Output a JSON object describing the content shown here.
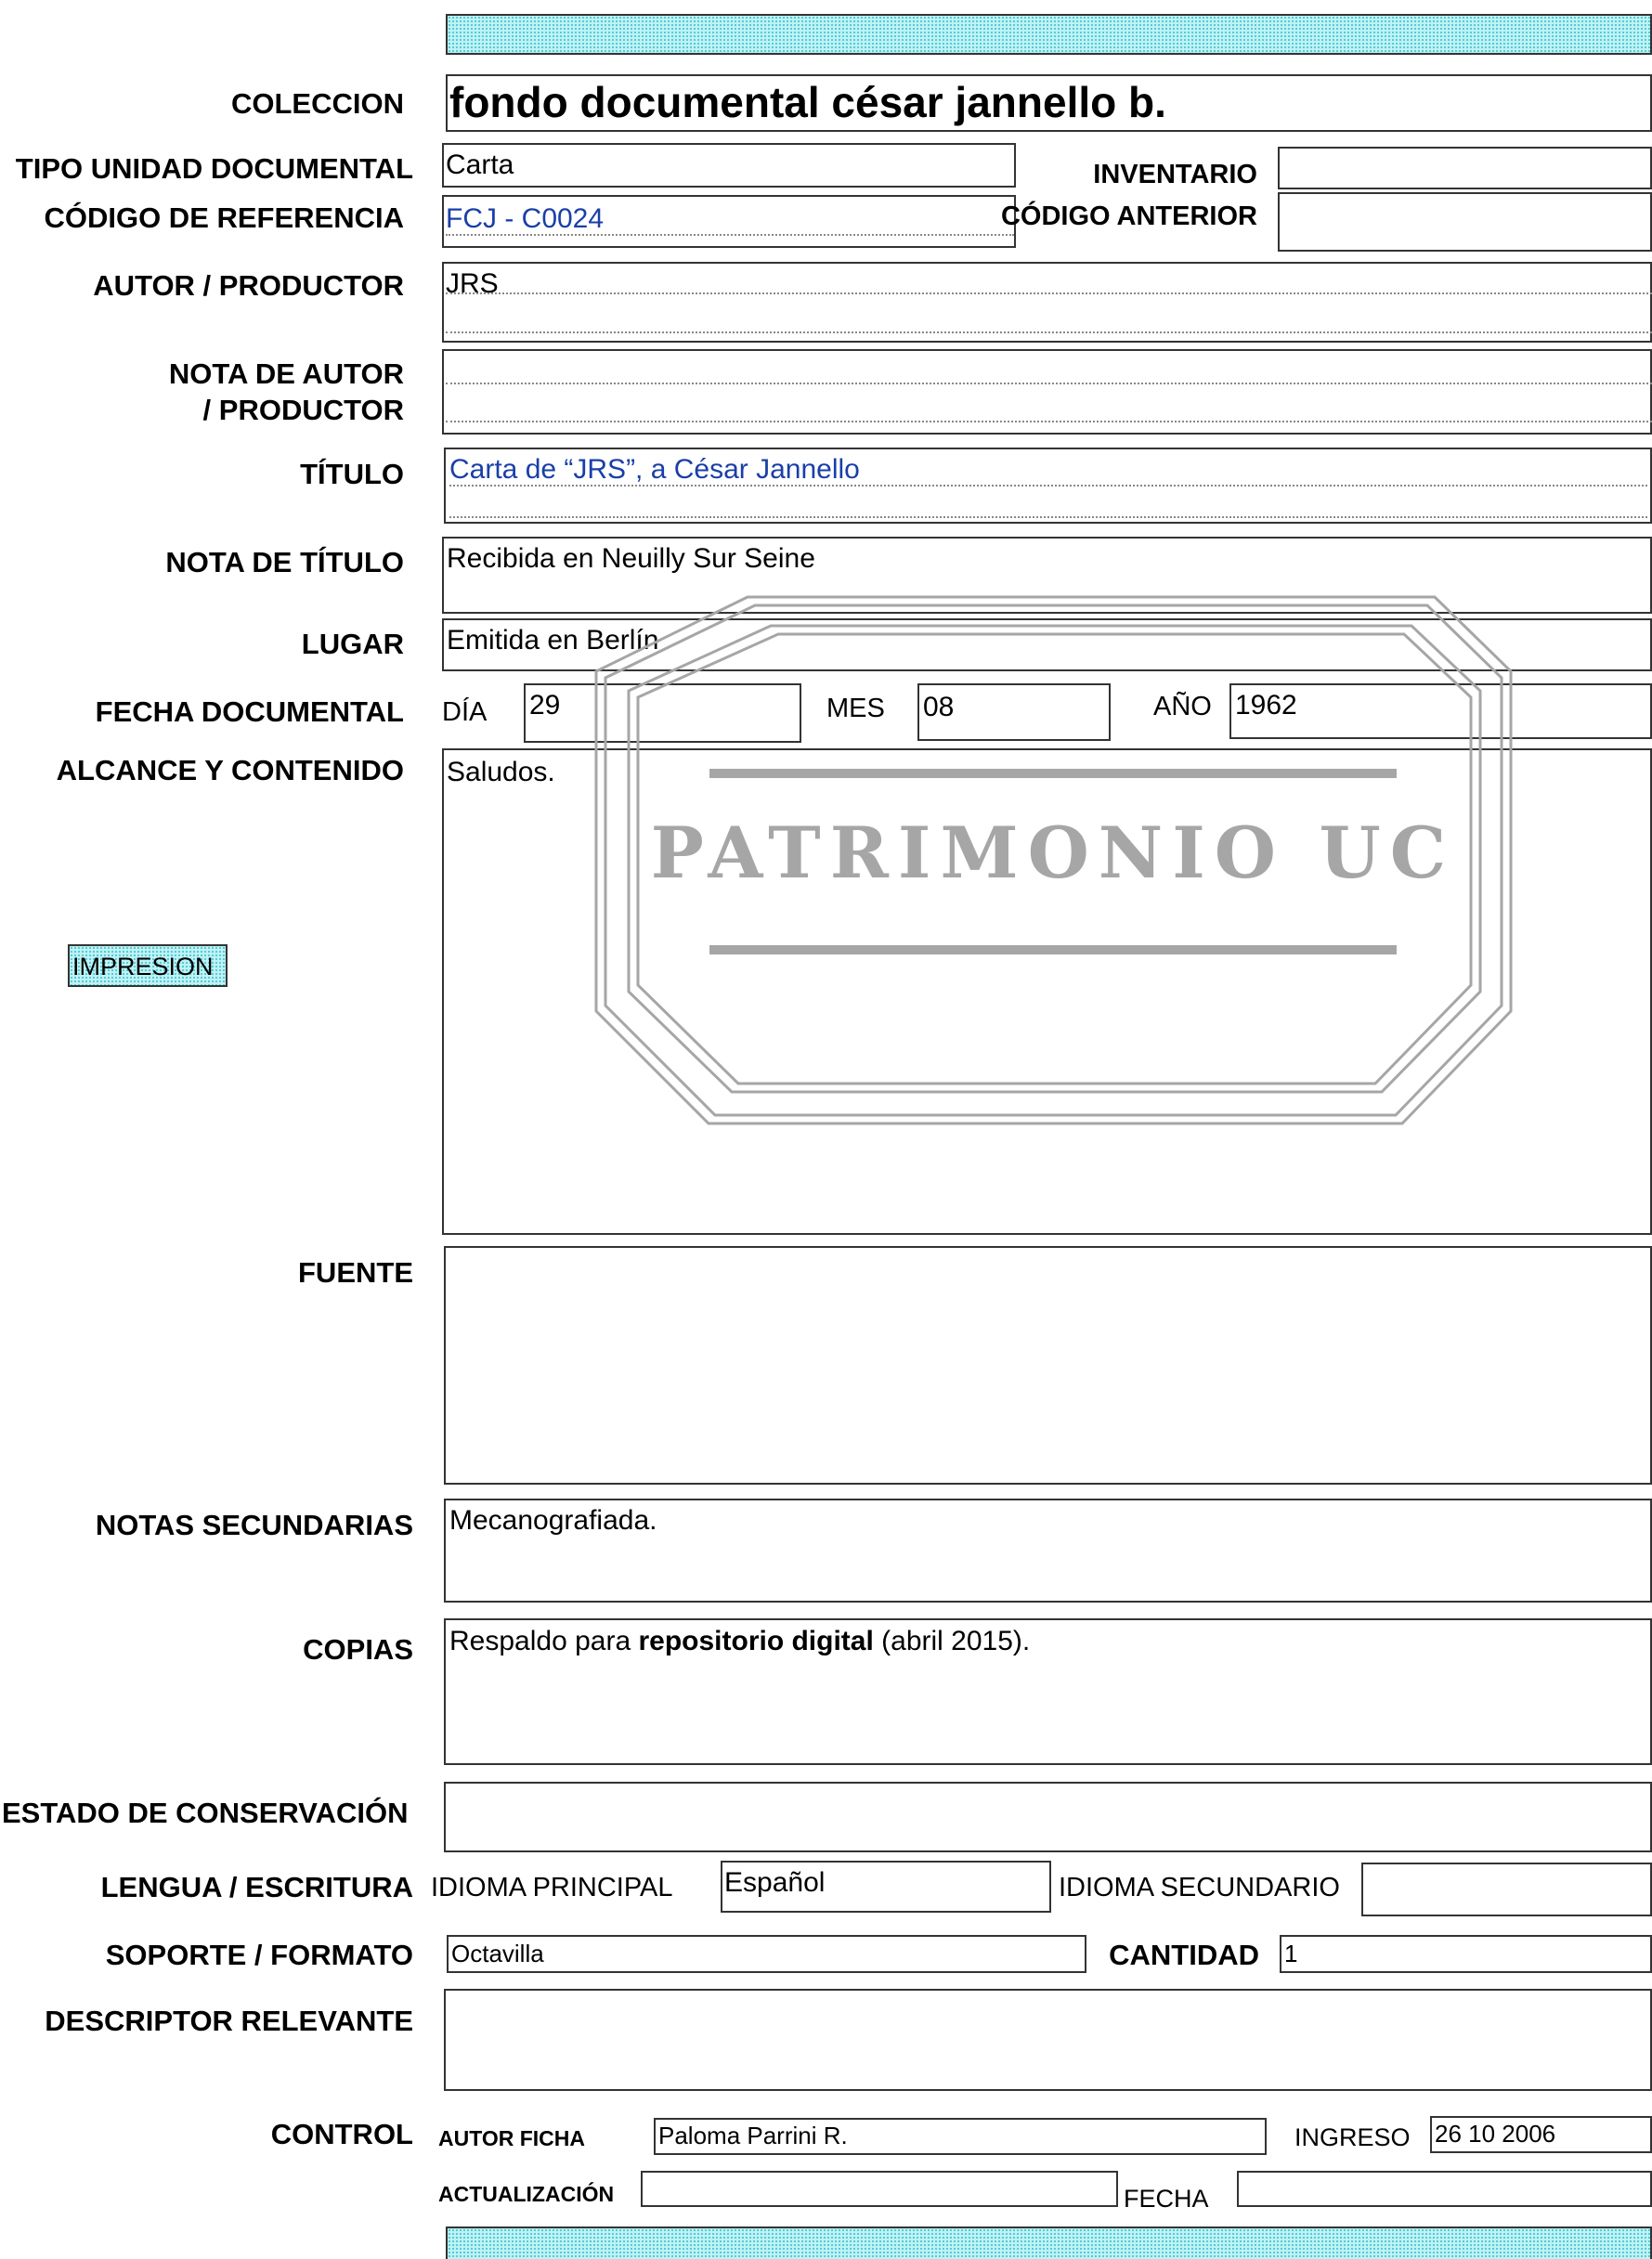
{
  "header": {
    "coleccion_label": "COLECCION",
    "coleccion_value": "fondo documental césar jannello b."
  },
  "fields": {
    "tipo_label": "TIPO UNIDAD DOCUMENTAL",
    "tipo_value": "Carta",
    "inventario_label": "INVENTARIO",
    "inventario_value": "",
    "codigo_label": "CÓDIGO DE REFERENCIA",
    "codigo_value": "FCJ - C0024",
    "codigo_anterior_label": "CÓDIGO ANTERIOR",
    "codigo_anterior_value": "",
    "autor_label": "AUTOR / PRODUCTOR",
    "autor_value": "JRS",
    "nota_autor_label_1": "NOTA DE AUTOR",
    "nota_autor_label_2": "/ PRODUCTOR",
    "nota_autor_value": "",
    "titulo_label": "TÍTULO",
    "titulo_value": "Carta de “JRS”, a César Jannello",
    "nota_titulo_label": "NOTA DE TÍTULO",
    "nota_titulo_value": "Recibida en Neuilly Sur Seine",
    "lugar_label": "LUGAR",
    "lugar_value": "Emitida en Berlín",
    "fecha_label": "FECHA DOCUMENTAL",
    "dia_label": "DÍA",
    "dia_value": "29",
    "mes_label": "MES",
    "mes_value": "08",
    "anio_label": "AÑO",
    "anio_value": "1962",
    "alcance_label": "ALCANCE Y CONTENIDO",
    "alcance_value": "Saludos.",
    "impresion_button": "IMPRESION",
    "fuente_label": "FUENTE",
    "fuente_value": "",
    "notas_label": "NOTAS SECUNDARIAS",
    "notas_value": "Mecanografiada.",
    "copias_label": "COPIAS",
    "copias_value_pre": "Respaldo para ",
    "copias_value_bold": "repositorio digital",
    "copias_value_post": " (abril 2015).",
    "estado_label": "ESTADO DE CONSERVACIÓN",
    "estado_value": "",
    "lengua_label": "LENGUA / ESCRITURA",
    "idioma_principal_label": "IDIOMA PRINCIPAL",
    "idioma_principal_value": "Español",
    "idioma_secundario_label": "IDIOMA SECUNDARIO",
    "idioma_secundario_value": "",
    "soporte_label": "SOPORTE / FORMATO",
    "soporte_value": "Octavilla",
    "cantidad_label": "CANTIDAD",
    "cantidad_value": "1",
    "descriptor_label": "DESCRIPTOR RELEVANTE",
    "descriptor_value": "",
    "control_label": "CONTROL",
    "autor_ficha_label": "AUTOR FICHA",
    "autor_ficha_value": "Paloma Parrini R.",
    "ingreso_label": "INGRESO",
    "ingreso_value": "26 10 2006",
    "actualizacion_label": "ACTUALIZACIÓN",
    "actualizacion_value": "",
    "fecha_act_label": "FECHA",
    "fecha_act_value": ""
  },
  "watermark": {
    "text": "PATRIMONIO UC"
  },
  "colors": {
    "hatch_bg": "#bff3f5",
    "link_blue": "#1a3fa8",
    "watermark_gray": "#a6a6a6"
  }
}
